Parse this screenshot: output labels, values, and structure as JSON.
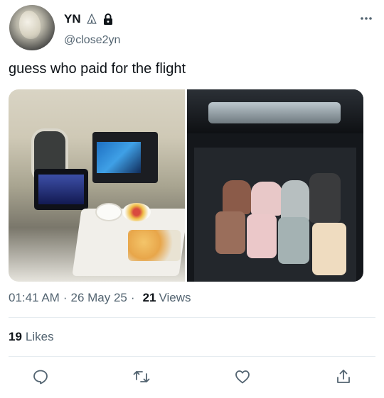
{
  "user": {
    "display_name": "YN",
    "handle": "@close2yn",
    "avatar_icon": "avatar",
    "badges": [
      "praying-hands-icon",
      "lock-icon"
    ]
  },
  "tweet": {
    "text": "guess who paid for the flight",
    "media": [
      {
        "description_icon": "photo-airplane-cabin"
      },
      {
        "description_icon": "photo-car-trunk-luggage"
      }
    ]
  },
  "meta": {
    "time": "01:41 AM",
    "date": "26 May 25",
    "separator": "·",
    "views_count": "21",
    "views_label": "Views"
  },
  "likes": {
    "count": "19",
    "label": "Likes"
  },
  "actions": [
    "reply-icon",
    "retweet-icon",
    "like-icon",
    "share-icon"
  ],
  "colors": {
    "text_primary": "#0f1419",
    "text_secondary": "#536471",
    "divider": "#e6ecf0",
    "icon": "#536471"
  }
}
